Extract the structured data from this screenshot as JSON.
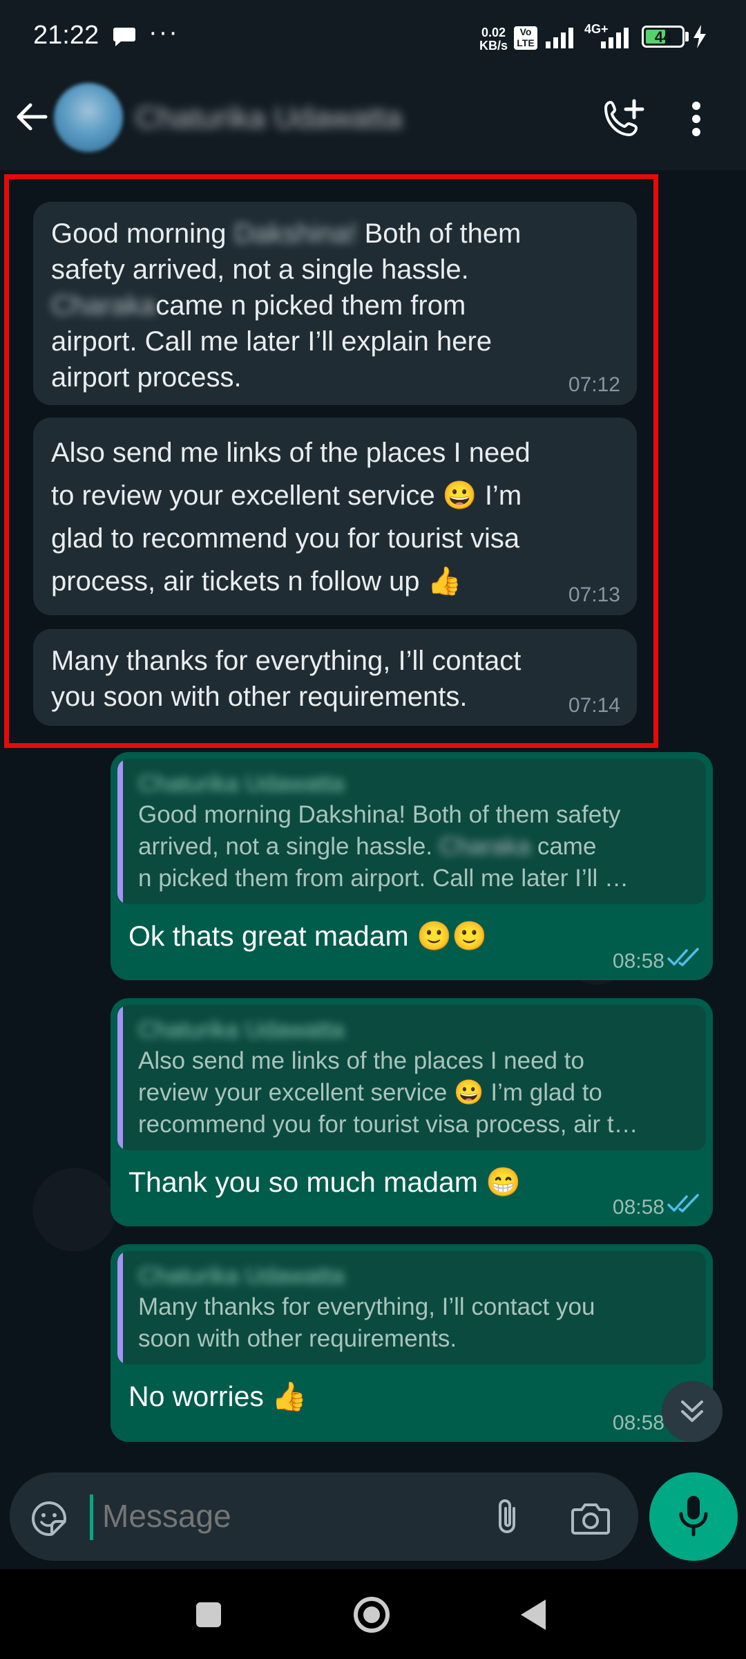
{
  "status_bar": {
    "time": "21:22",
    "dots": "···",
    "net_speed_value": "0.02",
    "net_speed_unit": "KB/s",
    "volte": "Vo LTE",
    "network": "4G+",
    "battery": "44"
  },
  "header": {
    "contact_name": "Chaturika Udawatta",
    "icons": [
      "back-arrow-icon",
      "add-call-icon",
      "more-vert-icon"
    ]
  },
  "messages_in": [
    {
      "parts": [
        "Good morning ",
        "Dakshina!",
        " Both of them\nsafety arrived, not a single hassle.\n",
        "Charaka",
        "came n picked them from\nairport. Call me later I’ll explain here\nairport process."
      ],
      "time": "07:12"
    },
    {
      "text": "Also send me links of the places I need\nto review your excellent service 😀 I’m\nglad to recommend you for tourist visa\nprocess, air tickets n follow up 👍",
      "time": "07:13"
    },
    {
      "text": "Many thanks for everything, I’ll contact\nyou soon with other requirements.",
      "time": "07:14"
    }
  ],
  "messages_out": [
    {
      "quote_name": "Chaturika Udawatta",
      "quote_parts": [
        "Good morning Dakshina! Both of them safety\narrived, not a single hassle. ",
        "Charaka",
        " came\nn picked them from airport. Call me later I’ll …"
      ],
      "reply": "Ok thats great madam 🙂🙂",
      "time": "08:58"
    },
    {
      "quote_name": "Chaturika Udawatta",
      "quote_text": "Also send me links of the places I need to\nreview your excellent service 😀 I’m glad to\nrecommend you for tourist visa process, air t…",
      "reply": "Thank you so much madam 😁",
      "time": "08:58"
    },
    {
      "quote_name": "Chaturika Udawatta",
      "quote_text": "Many thanks for everything, I’ll contact you\nsoon with other requirements.",
      "reply": "No worries 👍",
      "time": "08:58"
    }
  ],
  "input": {
    "placeholder": "Message"
  },
  "colors": {
    "highlight": "#e8090a",
    "accent": "#00a884",
    "outgoing_bubble": "#005c4b",
    "incoming_bubble": "#202c33",
    "read_ticks": "#53bdeb"
  }
}
